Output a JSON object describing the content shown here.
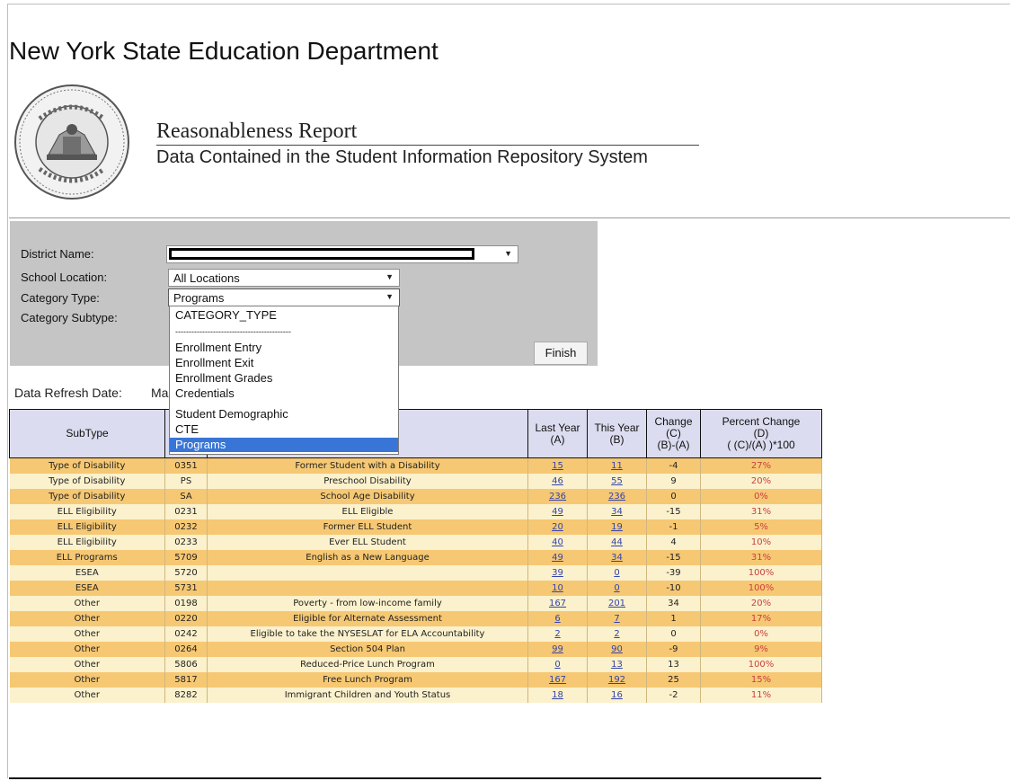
{
  "header": {
    "agency": "New York State Education Department",
    "report_title": "Reasonableness Report",
    "report_subtitle": "Data Contained in the Student Information Repository System"
  },
  "filters": {
    "district_label": "District Name:",
    "location_label": "School Location:",
    "location_value": "All Locations",
    "category_label": "Category Type:",
    "category_value": "Programs",
    "subtype_label": "Category Subtype:",
    "finish_label": "Finish"
  },
  "dropdown": {
    "items": [
      "CATEGORY_TYPE",
      "-------------------------------------------",
      "Enrollment Entry",
      "Enrollment Exit",
      "Enrollment Grades",
      "Credentials",
      "Student Demographic",
      "CTE",
      "Programs"
    ],
    "selected": "Programs"
  },
  "refresh": {
    "label": "Data Refresh Date:",
    "value": "Ma"
  },
  "table": {
    "headers": {
      "subtype": "SubType",
      "last_year": [
        "Last Year",
        "(A)"
      ],
      "this_year": [
        "This Year",
        "(B)"
      ],
      "change": [
        "Change",
        "(C)",
        "(B)-(A)"
      ],
      "percent": [
        "Percent Change",
        "(D)",
        "( (C)/(A) )*100"
      ]
    },
    "rows": [
      {
        "subtype": "Type of Disability",
        "code": "0351",
        "desc": "Former Student with a Disability",
        "last": "15",
        "this": "11",
        "change": "-4",
        "pct": "27%"
      },
      {
        "subtype": "Type of Disability",
        "code": "PS",
        "desc": "Preschool Disability",
        "last": "46",
        "this": "55",
        "change": "9",
        "pct": "20%"
      },
      {
        "subtype": "Type of Disability",
        "code": "SA",
        "desc": "School Age Disability",
        "last": "236",
        "this": "236",
        "change": "0",
        "pct": "0%"
      },
      {
        "subtype": "ELL Eligibility",
        "code": "0231",
        "desc": "ELL Eligible",
        "last": "49",
        "this": "34",
        "change": "-15",
        "pct": "31%"
      },
      {
        "subtype": "ELL Eligibility",
        "code": "0232",
        "desc": "Former ELL Student",
        "last": "20",
        "this": "19",
        "change": "-1",
        "pct": "5%"
      },
      {
        "subtype": "ELL Eligibility",
        "code": "0233",
        "desc": "Ever ELL Student",
        "last": "40",
        "this": "44",
        "change": "4",
        "pct": "10%"
      },
      {
        "subtype": "ELL Programs",
        "code": "5709",
        "desc": "English as a New Language",
        "last": "49",
        "this": "34",
        "change": "-15",
        "pct": "31%"
      },
      {
        "subtype": "ESEA",
        "code": "5720",
        "desc": "",
        "last": "39",
        "this": "0",
        "change": "-39",
        "pct": "100%"
      },
      {
        "subtype": "ESEA",
        "code": "5731",
        "desc": "",
        "last": "10",
        "this": "0",
        "change": "-10",
        "pct": "100%"
      },
      {
        "subtype": "Other",
        "code": "0198",
        "desc": "Poverty - from low-income family",
        "last": "167",
        "this": "201",
        "change": "34",
        "pct": "20%"
      },
      {
        "subtype": "Other",
        "code": "0220",
        "desc": "Eligible for Alternate Assessment",
        "last": "6",
        "this": "7",
        "change": "1",
        "pct": "17%"
      },
      {
        "subtype": "Other",
        "code": "0242",
        "desc": "Eligible to take the NYSESLAT for ELA Accountability",
        "last": "2",
        "this": "2",
        "change": "0",
        "pct": "0%"
      },
      {
        "subtype": "Other",
        "code": "0264",
        "desc": "Section 504 Plan",
        "last": "99",
        "this": "90",
        "change": "-9",
        "pct": "9%"
      },
      {
        "subtype": "Other",
        "code": "5806",
        "desc": "Reduced-Price Lunch Program",
        "last": "0",
        "this": "13",
        "change": "13",
        "pct": "100%"
      },
      {
        "subtype": "Other",
        "code": "5817",
        "desc": "Free Lunch Program",
        "last": "167",
        "this": "192",
        "change": "25",
        "pct": "15%"
      },
      {
        "subtype": "Other",
        "code": "8282",
        "desc": "Immigrant Children and Youth Status",
        "last": "18",
        "this": "16",
        "change": "-2",
        "pct": "11%"
      }
    ]
  }
}
